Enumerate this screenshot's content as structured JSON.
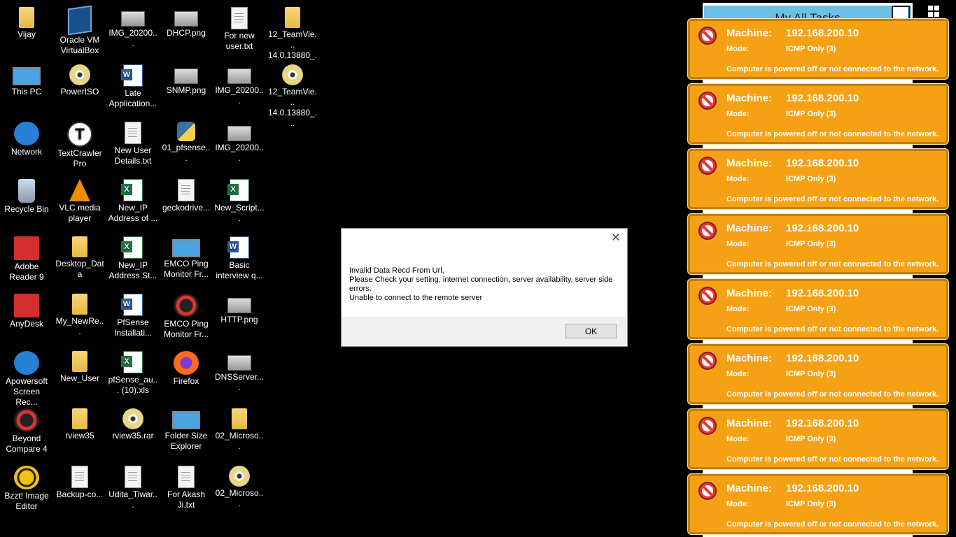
{
  "desktop": {
    "icons": [
      {
        "label": "Vijay",
        "icon": "user-folder-icon"
      },
      {
        "label": "This PC",
        "icon": "computer-icon"
      },
      {
        "label": "Network",
        "icon": "network-icon"
      },
      {
        "label": "Recycle Bin",
        "icon": "recycle-bin-icon"
      },
      {
        "label": "Adobe Reader 9",
        "icon": "adobe-reader-icon"
      },
      {
        "label": "AnyDesk",
        "icon": "anydesk-icon"
      },
      {
        "label": "Apowersoft Screen Rec...",
        "icon": "apowersoft-icon"
      },
      {
        "label": "Beyond Compare 4",
        "icon": "beyond-compare-icon"
      },
      {
        "label": "Bzzt! Image Editor",
        "icon": "bzzt-icon"
      },
      {
        "label": "Oracle VM VirtualBox",
        "icon": "virtualbox-icon"
      },
      {
        "label": "PowerISO",
        "icon": "poweriso-icon"
      },
      {
        "label": "TextCrawler Pro",
        "icon": "textcrawler-icon"
      },
      {
        "label": "VLC media player",
        "icon": "vlc-icon"
      },
      {
        "label": "Desktop_Data",
        "icon": "folder-icon"
      },
      {
        "label": "My_NewRe...",
        "icon": "folder-icon"
      },
      {
        "label": "New_User",
        "icon": "folder-icon"
      },
      {
        "label": "rview35",
        "icon": "folder-icon"
      },
      {
        "label": "Backup-co...",
        "icon": "file-icon"
      },
      {
        "label": "IMG_20200...",
        "icon": "image-icon"
      },
      {
        "label": "Late Application...",
        "icon": "word-doc-icon"
      },
      {
        "label": "New User Details.txt",
        "icon": "text-file-icon"
      },
      {
        "label": "New_IP Address of ...",
        "icon": "excel-icon"
      },
      {
        "label": "New_IP Address St...",
        "icon": "excel-icon"
      },
      {
        "label": "PfSense Installati...",
        "icon": "word-doc-icon"
      },
      {
        "label": "pfSense_au... (10).xls",
        "icon": "excel-icon"
      },
      {
        "label": "rview35.rar",
        "icon": "disc-icon"
      },
      {
        "label": "Udita_Tiwar...",
        "icon": "file-icon"
      },
      {
        "label": "DHCP.png",
        "icon": "image-icon"
      },
      {
        "label": "SNMP.png",
        "icon": "image-icon"
      },
      {
        "label": "01_pfsense...",
        "icon": "python-icon"
      },
      {
        "label": "geckodrive...",
        "icon": "file-icon"
      },
      {
        "label": "EMCO Ping Monitor Fr...",
        "icon": "emco-monitor-icon"
      },
      {
        "label": "EMCO Ping Monitor Fr...",
        "icon": "emco-pm-icon"
      },
      {
        "label": "Firefox",
        "icon": "firefox-icon"
      },
      {
        "label": "Folder Size Explorer",
        "icon": "folder-size-icon"
      },
      {
        "label": "For Akash Ji.txt",
        "icon": "text-file-icon"
      },
      {
        "label": "For new user.txt",
        "icon": "text-file-icon"
      },
      {
        "label": "IMG_20200...",
        "icon": "image-icon"
      },
      {
        "label": "IMG_20200...",
        "icon": "image-icon"
      },
      {
        "label": "New_Script....",
        "icon": "excel-icon"
      },
      {
        "label": "Basic interview q...",
        "icon": "word-doc-icon"
      },
      {
        "label": "HTTP.png",
        "icon": "image-icon"
      },
      {
        "label": "DNSServer....",
        "icon": "image-icon"
      },
      {
        "label": "02_Microso...",
        "icon": "folder-icon"
      },
      {
        "label": "02_Microso...",
        "icon": "disc-icon"
      },
      {
        "label": "12_TeamVie... 14.0.13880_...",
        "icon": "folder-icon"
      },
      {
        "label": "12_TeamVie... 14.0.13880_...",
        "icon": "disc-icon"
      }
    ]
  },
  "tasks_window": {
    "title": "My All Tasks"
  },
  "notifications": [
    {
      "machine_label": "Machine:",
      "machine": "192.168.200.10",
      "mode_label": "Mode:",
      "mode": "ICMP Only (3)",
      "message": "Computer is powered off or not connected to the network."
    },
    {
      "machine_label": "Machine:",
      "machine": "192.168.200.10",
      "mode_label": "Mode:",
      "mode": "ICMP Only (3)",
      "message": "Computer is powered off or not connected to the network."
    },
    {
      "machine_label": "Machine:",
      "machine": "192.168.200.10",
      "mode_label": "Mode:",
      "mode": "ICMP Only (3)",
      "message": "Computer is powered off or not connected to the network."
    },
    {
      "machine_label": "Machine:",
      "machine": "192.168.200.10",
      "mode_label": "Mode:",
      "mode": "ICMP Only (3)",
      "message": "Computer is powered off or not connected to the network."
    },
    {
      "machine_label": "Machine:",
      "machine": "192.168.200.10",
      "mode_label": "Mode:",
      "mode": "ICMP Only (3)",
      "message": "Computer is powered off or not connected to the network."
    },
    {
      "machine_label": "Machine:",
      "machine": "192.168.200.10",
      "mode_label": "Mode:",
      "mode": "ICMP Only (3)",
      "message": "Computer is powered off or not connected to the network."
    },
    {
      "machine_label": "Machine:",
      "machine": "192.168.200.10",
      "mode_label": "Mode:",
      "mode": "ICMP Only (3)",
      "message": "Computer is powered off or not connected to the network."
    },
    {
      "machine_label": "Machine:",
      "machine": "192.168.200.10",
      "mode_label": "Mode:",
      "mode": "ICMP Only (3)",
      "message": "Computer is powered off or not connected to the network."
    }
  ],
  "dialog": {
    "lines": [
      "Invalid Data Recd From Url,",
      "Please Check your setting, internet connection, server availability, server side errors.",
      "Unable to connect to the remote server"
    ],
    "ok_label": "OK",
    "close_glyph": "✕"
  },
  "colors": {
    "notification_bg": "#f5a115",
    "notification_border": "#c47f08",
    "stop_icon": "#e53935",
    "tasks_title_bg": "#6cc0e8"
  }
}
